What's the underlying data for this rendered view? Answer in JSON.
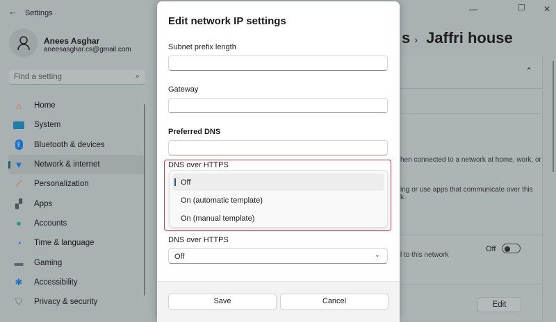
{
  "app": {
    "title": "Settings"
  },
  "user": {
    "name": "Anees Asghar",
    "email": "aneesasghar.cs@gmail.com"
  },
  "search": {
    "placeholder": "Find a setting"
  },
  "nav": [
    {
      "label": "Home",
      "icon": "home-icon"
    },
    {
      "label": "System",
      "icon": "system-icon"
    },
    {
      "label": "Bluetooth & devices",
      "icon": "bluetooth-icon"
    },
    {
      "label": "Network & internet",
      "icon": "wifi-icon",
      "selected": true
    },
    {
      "label": "Personalization",
      "icon": "brush-icon"
    },
    {
      "label": "Apps",
      "icon": "apps-icon"
    },
    {
      "label": "Accounts",
      "icon": "accounts-icon"
    },
    {
      "label": "Time & language",
      "icon": "globe-clock-icon"
    },
    {
      "label": "Gaming",
      "icon": "gamepad-icon"
    },
    {
      "label": "Accessibility",
      "icon": "accessibility-icon"
    },
    {
      "label": "Privacy & security",
      "icon": "shield-icon"
    }
  ],
  "breadcrumb": {
    "partial": "s",
    "current": "Jaffri house"
  },
  "background": {
    "text1": "hen connected to a network at home, work, or",
    "text2": "ing or use apps that communicate over this",
    "text3": "k.",
    "text4": "l to this network",
    "toggle_label": "Off",
    "edit_label": "Edit"
  },
  "dialog": {
    "title": "Edit network IP settings",
    "subnet_label": "Subnet prefix length",
    "subnet_value": "",
    "gateway_label": "Gateway",
    "gateway_value": "",
    "dns_label": "Preferred DNS",
    "dns_value": "",
    "doh_label_top": "DNS over HTTPS",
    "doh_options": [
      "Off",
      "On (automatic template)",
      "On (manual template)"
    ],
    "doh_label": "DNS over HTTPS",
    "doh_value": "Off",
    "save": "Save",
    "cancel": "Cancel"
  },
  "colors": {
    "accent": "#1b5e6e",
    "highlight": "#e8343e"
  }
}
